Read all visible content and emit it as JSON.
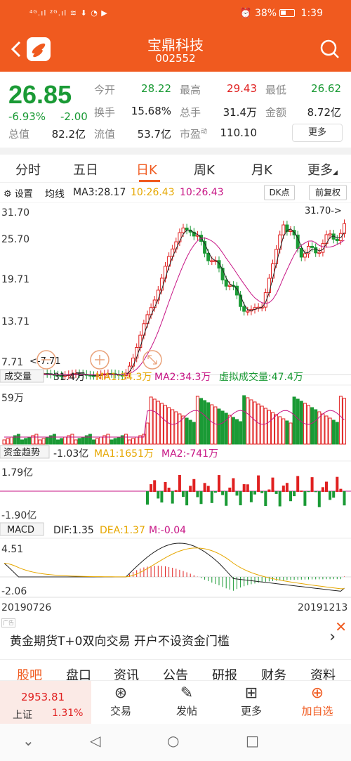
{
  "status": {
    "left": "⁴ᴳ.ıl ²ᴳ.ıl ≋ ⬇ ◔ ▶",
    "battery": "38%",
    "time": "1:39"
  },
  "header": {
    "title": "宝鼎科技",
    "code": "002552"
  },
  "quote": {
    "price": "26.85",
    "change_pct": "-6.93%",
    "change": "-2.00",
    "open_label": "今开",
    "open": "28.22",
    "high_label": "最高",
    "high": "29.43",
    "low_label": "最低",
    "low": "26.62",
    "turnover_label": "换手",
    "turnover": "15.68%",
    "volume_label": "总手",
    "volume": "31.4万",
    "amount_label": "金额",
    "amount": "8.72亿",
    "mktcap_label": "总值",
    "mktcap": "82.2亿",
    "float_label": "流值",
    "float": "53.7亿",
    "pe_label": "市盈",
    "pe_sup": "动",
    "pe": "110.10",
    "more": "更多"
  },
  "tabs": [
    "分时",
    "五日",
    "日K",
    "周K",
    "月K",
    "更多"
  ],
  "toolbar": {
    "settings": "设置",
    "ma_label": "均线",
    "ma3": "MA3:28.17",
    "ma_a": "10:26.43",
    "ma_b": "10:26.43",
    "dk": "DK点",
    "adjust": "前复权"
  },
  "kline": {
    "y_labels": [
      "31.70",
      "25.70",
      "19.71",
      "13.71",
      "7.71"
    ],
    "max_label": "31.70->",
    "min_label": "<-7.71"
  },
  "volume": {
    "tag": "成交量",
    "value": "31.4万",
    "ma1": "MA1:34.3万",
    "ma2": "MA2:34.3万",
    "virtual": "虚拟成交量:47.4万",
    "y_top": "59万"
  },
  "fund": {
    "tag": "资金趋势",
    "value": "-1.03亿",
    "ma1": "MA1:1651万",
    "ma2": "MA2:-741万",
    "y_top": "1.79亿",
    "y_bot": "-1.90亿"
  },
  "macd": {
    "tag": "MACD",
    "dif": "DIF:1.35",
    "dea": "DEA:1.37",
    "m": "M:-0.04",
    "y_top": "4.51",
    "y_bot": "-2.06",
    "date_start": "20190726",
    "date_end": "20191213"
  },
  "ad": {
    "text": "黄金期货T+0双向交易 开户不设资金门槛",
    "tag": "广告"
  },
  "subnav": [
    "股吧",
    "盘口",
    "资讯",
    "公告",
    "研报",
    "财务",
    "资料"
  ],
  "index": {
    "value": "2953.81",
    "name": "上证",
    "pct": "1.31%"
  },
  "bottom": [
    "交易",
    "发帖",
    "更多",
    "加自选"
  ],
  "colors": {
    "brand": "#f05a1f",
    "up": "#e02020",
    "down": "#1a9a35"
  }
}
